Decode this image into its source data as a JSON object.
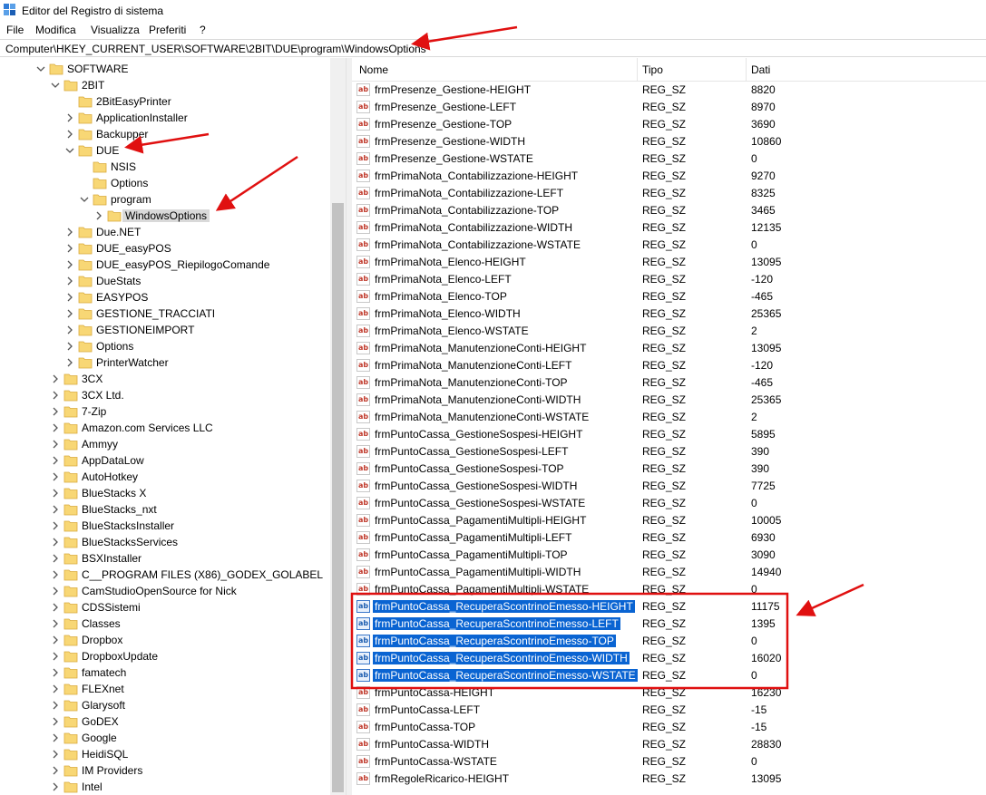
{
  "window": {
    "title": "Editor del Registro di sistema"
  },
  "menu": [
    "File",
    "Modifica",
    "Visualizza",
    "Preferiti",
    "?"
  ],
  "address": "Computer\\HKEY_CURRENT_USER\\SOFTWARE\\2BIT\\DUE\\program\\WindowsOptions",
  "tree": [
    {
      "label": "SOFTWARE",
      "level": 0,
      "state": "expanded"
    },
    {
      "label": "2BIT",
      "level": 1,
      "state": "expanded"
    },
    {
      "label": "2BitEasyPrinter",
      "level": 2,
      "state": "none"
    },
    {
      "label": "ApplicationInstaller",
      "level": 2,
      "state": "collapsed"
    },
    {
      "label": "Backupper",
      "level": 2,
      "state": "collapsed"
    },
    {
      "label": "DUE",
      "level": 2,
      "state": "expanded"
    },
    {
      "label": "NSIS",
      "level": 3,
      "state": "none"
    },
    {
      "label": "Options",
      "level": 3,
      "state": "none"
    },
    {
      "label": "program",
      "level": 3,
      "state": "expanded"
    },
    {
      "label": "WindowsOptions",
      "level": 4,
      "state": "collapsed",
      "selected": true
    },
    {
      "label": "Due.NET",
      "level": 2,
      "state": "collapsed"
    },
    {
      "label": "DUE_easyPOS",
      "level": 2,
      "state": "collapsed"
    },
    {
      "label": "DUE_easyPOS_RiepilogoComande",
      "level": 2,
      "state": "collapsed"
    },
    {
      "label": "DueStats",
      "level": 2,
      "state": "collapsed"
    },
    {
      "label": "EASYPOS",
      "level": 2,
      "state": "collapsed"
    },
    {
      "label": "GESTIONE_TRACCIATI",
      "level": 2,
      "state": "collapsed"
    },
    {
      "label": "GESTIONEIMPORT",
      "level": 2,
      "state": "collapsed"
    },
    {
      "label": "Options",
      "level": 2,
      "state": "collapsed"
    },
    {
      "label": "PrinterWatcher",
      "level": 2,
      "state": "collapsed"
    },
    {
      "label": "3CX",
      "level": 1,
      "state": "collapsed"
    },
    {
      "label": "3CX Ltd.",
      "level": 1,
      "state": "collapsed"
    },
    {
      "label": "7-Zip",
      "level": 1,
      "state": "collapsed"
    },
    {
      "label": "Amazon.com Services LLC",
      "level": 1,
      "state": "collapsed"
    },
    {
      "label": "Ammyy",
      "level": 1,
      "state": "collapsed"
    },
    {
      "label": "AppDataLow",
      "level": 1,
      "state": "collapsed"
    },
    {
      "label": "AutoHotkey",
      "level": 1,
      "state": "collapsed"
    },
    {
      "label": "BlueStacks X",
      "level": 1,
      "state": "collapsed"
    },
    {
      "label": "BlueStacks_nxt",
      "level": 1,
      "state": "collapsed"
    },
    {
      "label": "BlueStacksInstaller",
      "level": 1,
      "state": "collapsed"
    },
    {
      "label": "BlueStacksServices",
      "level": 1,
      "state": "collapsed"
    },
    {
      "label": "BSXInstaller",
      "level": 1,
      "state": "collapsed"
    },
    {
      "label": "C__PROGRAM FILES (X86)_GODEX_GOLABEL",
      "level": 1,
      "state": "collapsed"
    },
    {
      "label": "CamStudioOpenSource for Nick",
      "level": 1,
      "state": "collapsed"
    },
    {
      "label": "CDSSistemi",
      "level": 1,
      "state": "collapsed"
    },
    {
      "label": "Classes",
      "level": 1,
      "state": "collapsed"
    },
    {
      "label": "Dropbox",
      "level": 1,
      "state": "collapsed"
    },
    {
      "label": "DropboxUpdate",
      "level": 1,
      "state": "collapsed"
    },
    {
      "label": "famatech",
      "level": 1,
      "state": "collapsed"
    },
    {
      "label": "FLEXnet",
      "level": 1,
      "state": "collapsed"
    },
    {
      "label": "Glarysoft",
      "level": 1,
      "state": "collapsed"
    },
    {
      "label": "GoDEX",
      "level": 1,
      "state": "collapsed"
    },
    {
      "label": "Google",
      "level": 1,
      "state": "collapsed"
    },
    {
      "label": "HeidiSQL",
      "level": 1,
      "state": "collapsed"
    },
    {
      "label": "IM Providers",
      "level": 1,
      "state": "collapsed"
    },
    {
      "label": "Intel",
      "level": 1,
      "state": "collapsed"
    }
  ],
  "list": {
    "columns": {
      "name": "Nome",
      "type": "Tipo",
      "data": "Dati"
    },
    "icon_glyph": "ab",
    "rows": [
      {
        "name": "frmPresenze_Gestione-HEIGHT",
        "type": "REG_SZ",
        "data": "8820"
      },
      {
        "name": "frmPresenze_Gestione-LEFT",
        "type": "REG_SZ",
        "data": "8970"
      },
      {
        "name": "frmPresenze_Gestione-TOP",
        "type": "REG_SZ",
        "data": "3690"
      },
      {
        "name": "frmPresenze_Gestione-WIDTH",
        "type": "REG_SZ",
        "data": "10860"
      },
      {
        "name": "frmPresenze_Gestione-WSTATE",
        "type": "REG_SZ",
        "data": "0"
      },
      {
        "name": "frmPrimaNota_Contabilizzazione-HEIGHT",
        "type": "REG_SZ",
        "data": "9270"
      },
      {
        "name": "frmPrimaNota_Contabilizzazione-LEFT",
        "type": "REG_SZ",
        "data": "8325"
      },
      {
        "name": "frmPrimaNota_Contabilizzazione-TOP",
        "type": "REG_SZ",
        "data": "3465"
      },
      {
        "name": "frmPrimaNota_Contabilizzazione-WIDTH",
        "type": "REG_SZ",
        "data": "12135"
      },
      {
        "name": "frmPrimaNota_Contabilizzazione-WSTATE",
        "type": "REG_SZ",
        "data": "0"
      },
      {
        "name": "frmPrimaNota_Elenco-HEIGHT",
        "type": "REG_SZ",
        "data": "13095"
      },
      {
        "name": "frmPrimaNota_Elenco-LEFT",
        "type": "REG_SZ",
        "data": "-120"
      },
      {
        "name": "frmPrimaNota_Elenco-TOP",
        "type": "REG_SZ",
        "data": "-465"
      },
      {
        "name": "frmPrimaNota_Elenco-WIDTH",
        "type": "REG_SZ",
        "data": "25365"
      },
      {
        "name": "frmPrimaNota_Elenco-WSTATE",
        "type": "REG_SZ",
        "data": "2"
      },
      {
        "name": "frmPrimaNota_ManutenzioneConti-HEIGHT",
        "type": "REG_SZ",
        "data": "13095"
      },
      {
        "name": "frmPrimaNota_ManutenzioneConti-LEFT",
        "type": "REG_SZ",
        "data": "-120"
      },
      {
        "name": "frmPrimaNota_ManutenzioneConti-TOP",
        "type": "REG_SZ",
        "data": "-465"
      },
      {
        "name": "frmPrimaNota_ManutenzioneConti-WIDTH",
        "type": "REG_SZ",
        "data": "25365"
      },
      {
        "name": "frmPrimaNota_ManutenzioneConti-WSTATE",
        "type": "REG_SZ",
        "data": "2"
      },
      {
        "name": "frmPuntoCassa_GestioneSospesi-HEIGHT",
        "type": "REG_SZ",
        "data": "5895"
      },
      {
        "name": "frmPuntoCassa_GestioneSospesi-LEFT",
        "type": "REG_SZ",
        "data": "390"
      },
      {
        "name": "frmPuntoCassa_GestioneSospesi-TOP",
        "type": "REG_SZ",
        "data": "390"
      },
      {
        "name": "frmPuntoCassa_GestioneSospesi-WIDTH",
        "type": "REG_SZ",
        "data": "7725"
      },
      {
        "name": "frmPuntoCassa_GestioneSospesi-WSTATE",
        "type": "REG_SZ",
        "data": "0"
      },
      {
        "name": "frmPuntoCassa_PagamentiMultipli-HEIGHT",
        "type": "REG_SZ",
        "data": "10005"
      },
      {
        "name": "frmPuntoCassa_PagamentiMultipli-LEFT",
        "type": "REG_SZ",
        "data": "6930"
      },
      {
        "name": "frmPuntoCassa_PagamentiMultipli-TOP",
        "type": "REG_SZ",
        "data": "3090"
      },
      {
        "name": "frmPuntoCassa_PagamentiMultipli-WIDTH",
        "type": "REG_SZ",
        "data": "14940"
      },
      {
        "name": "frmPuntoCassa_PagamentiMultipli-WSTATE",
        "type": "REG_SZ",
        "data": "0"
      },
      {
        "name": "frmPuntoCassa_RecuperaScontrinoEmesso-HEIGHT",
        "type": "REG_SZ",
        "data": "11175",
        "selected": true
      },
      {
        "name": "frmPuntoCassa_RecuperaScontrinoEmesso-LEFT",
        "type": "REG_SZ",
        "data": "1395",
        "selected": true
      },
      {
        "name": "frmPuntoCassa_RecuperaScontrinoEmesso-TOP",
        "type": "REG_SZ",
        "data": "0",
        "selected": true
      },
      {
        "name": "frmPuntoCassa_RecuperaScontrinoEmesso-WIDTH",
        "type": "REG_SZ",
        "data": "16020",
        "selected": true
      },
      {
        "name": "frmPuntoCassa_RecuperaScontrinoEmesso-WSTATE",
        "type": "REG_SZ",
        "data": "0",
        "selected": true
      },
      {
        "name": "frmPuntoCassa-HEIGHT",
        "type": "REG_SZ",
        "data": "16230"
      },
      {
        "name": "frmPuntoCassa-LEFT",
        "type": "REG_SZ",
        "data": "-15"
      },
      {
        "name": "frmPuntoCassa-TOP",
        "type": "REG_SZ",
        "data": "-15"
      },
      {
        "name": "frmPuntoCassa-WIDTH",
        "type": "REG_SZ",
        "data": "28830"
      },
      {
        "name": "frmPuntoCassa-WSTATE",
        "type": "REG_SZ",
        "data": "0"
      },
      {
        "name": "frmRegoleRicarico-HEIGHT",
        "type": "REG_SZ",
        "data": "13095"
      }
    ]
  },
  "colors": {
    "selection": "#0a64d2",
    "annotation": "#e01010",
    "folder": "#f8d775",
    "tree_selected": "#d9d9d9"
  }
}
